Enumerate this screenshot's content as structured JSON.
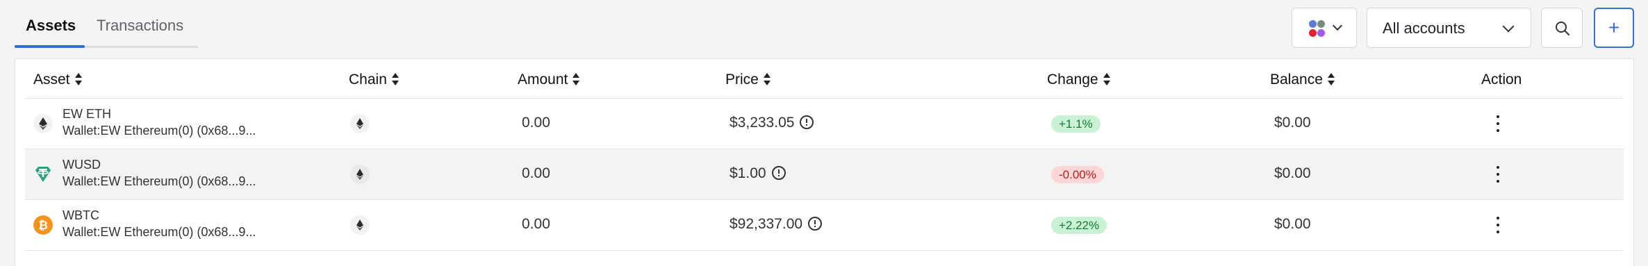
{
  "tabs": [
    {
      "label": "Assets",
      "active": true
    },
    {
      "label": "Transactions",
      "active": false
    }
  ],
  "toolbar": {
    "network_filter_icons": [
      "ethereum-icon",
      "generic-network-icon",
      "red-network-icon",
      "purple-network-icon"
    ],
    "account_select": {
      "selected": "All accounts"
    },
    "search_icon": "search-icon",
    "add_label": "+"
  },
  "table": {
    "columns": [
      "Asset",
      "Chain",
      "Amount",
      "Price",
      "Change",
      "Balance",
      "Action"
    ],
    "rows": [
      {
        "asset": "EW ETH",
        "wallet": "Wallet:EW Ethereum(0) (0x68...9...",
        "asset_icon": "ethereum-icon",
        "chain_icon": "ethereum-icon",
        "amount": "0.00",
        "price": "$3,233.05",
        "change": "+1.1%",
        "change_dir": "up",
        "balance": "$0.00"
      },
      {
        "asset": "WUSD",
        "wallet": "Wallet:EW Ethereum(0) (0x68...9...",
        "asset_icon": "tether-icon",
        "chain_icon": "ethereum-icon",
        "amount": "0.00",
        "price": "$1.00",
        "change": "-0.00%",
        "change_dir": "down",
        "balance": "$0.00"
      },
      {
        "asset": "WBTC",
        "wallet": "Wallet:EW Ethereum(0) (0x68...9...",
        "asset_icon": "bitcoin-icon",
        "chain_icon": "ethereum-icon",
        "amount": "0.00",
        "price": "$92,337.00",
        "change": "+2.22%",
        "change_dir": "up",
        "balance": "$0.00"
      }
    ]
  },
  "colors": {
    "accent": "#2f6fd6",
    "tether": "#26a17b",
    "bitcoin": "#f7931a",
    "positive_bg": "#c8f2d3",
    "negative_bg": "#ffd6d6"
  }
}
